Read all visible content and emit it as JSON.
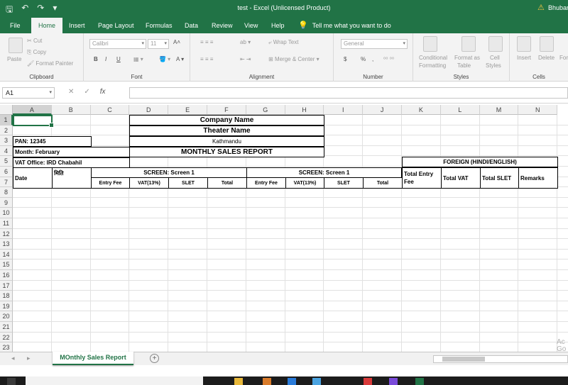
{
  "window": {
    "title": "test  -  Excel (Unlicensed Product)",
    "user": "Bhubar",
    "quick_access": [
      "save-icon",
      "undo-icon",
      "redo-icon",
      "customize-icon"
    ]
  },
  "tabs": [
    "File",
    "Home",
    "Insert",
    "Page Layout",
    "Formulas",
    "Data",
    "Review",
    "View",
    "Help"
  ],
  "active_tab": "Home",
  "tell_me": "Tell me what you want to do",
  "ribbon": {
    "clipboard": {
      "label": "Clipboard",
      "paste": "Paste",
      "cut": "Cut",
      "copy": "Copy",
      "format_painter": "Format Painter"
    },
    "font": {
      "label": "Font",
      "name": "Calibri",
      "size": "11",
      "bold": "B",
      "italic": "I",
      "underline": "U"
    },
    "alignment": {
      "label": "Alignment",
      "wrap_text": "Wrap Text",
      "merge_center": "Merge & Center"
    },
    "number": {
      "label": "Number",
      "format": "General",
      "currency": "$",
      "percent": "%",
      "comma": ","
    },
    "styles": {
      "label": "Styles",
      "conditional": "Conditional",
      "conditional2": "Formatting",
      "format_as": "Format as",
      "table": "Table",
      "cell": "Cell",
      "styles": "Styles"
    },
    "cells": {
      "label": "Cells",
      "insert": "Insert",
      "delete": "Delete",
      "format": "For"
    }
  },
  "formula_bar": {
    "name_box": "A1",
    "cancel": "✕",
    "enter": "✓",
    "fx": "fx",
    "value": ""
  },
  "columns": [
    "A",
    "B",
    "C",
    "D",
    "E",
    "F",
    "G",
    "H",
    "I",
    "J",
    "K",
    "L",
    "M",
    "N"
  ],
  "rows": [
    "1",
    "2",
    "3",
    "4",
    "5",
    "6",
    "7",
    "8",
    "9",
    "10",
    "11",
    "12",
    "13",
    "14",
    "15",
    "16",
    "17",
    "18",
    "19",
    "20",
    "21",
    "22",
    "23"
  ],
  "report": {
    "company": "Company Name",
    "theater": "Theater Name",
    "city": "Kathmandu",
    "pan": "PAN: 12345",
    "month": "Month: February",
    "vat_office": "VAT Office: IRD Chabahil",
    "report_title": "MONTHLY SALES REPORT",
    "foreign": "FOREIGN (HINDI/ENGLISH)",
    "date": "Date",
    "miti": "मिति",
    "screen1": "SCREEN: Screen 1",
    "screen2": "SCREEN: Screen 1",
    "entry_fee": "Entry Fee",
    "vat": "VAT(13%)",
    "slet": "SLET",
    "total": "Total",
    "total_entry_fee": "Total Entry Fee",
    "total_vat": "Total VAT",
    "total_slet": "Total SLET",
    "remarks": "Remarks"
  },
  "sheet_tab": "MOnthly Sales Report",
  "add_sheet": "+",
  "watermark": "Ac\nGo",
  "theme": {
    "excel_green": "#217346"
  }
}
